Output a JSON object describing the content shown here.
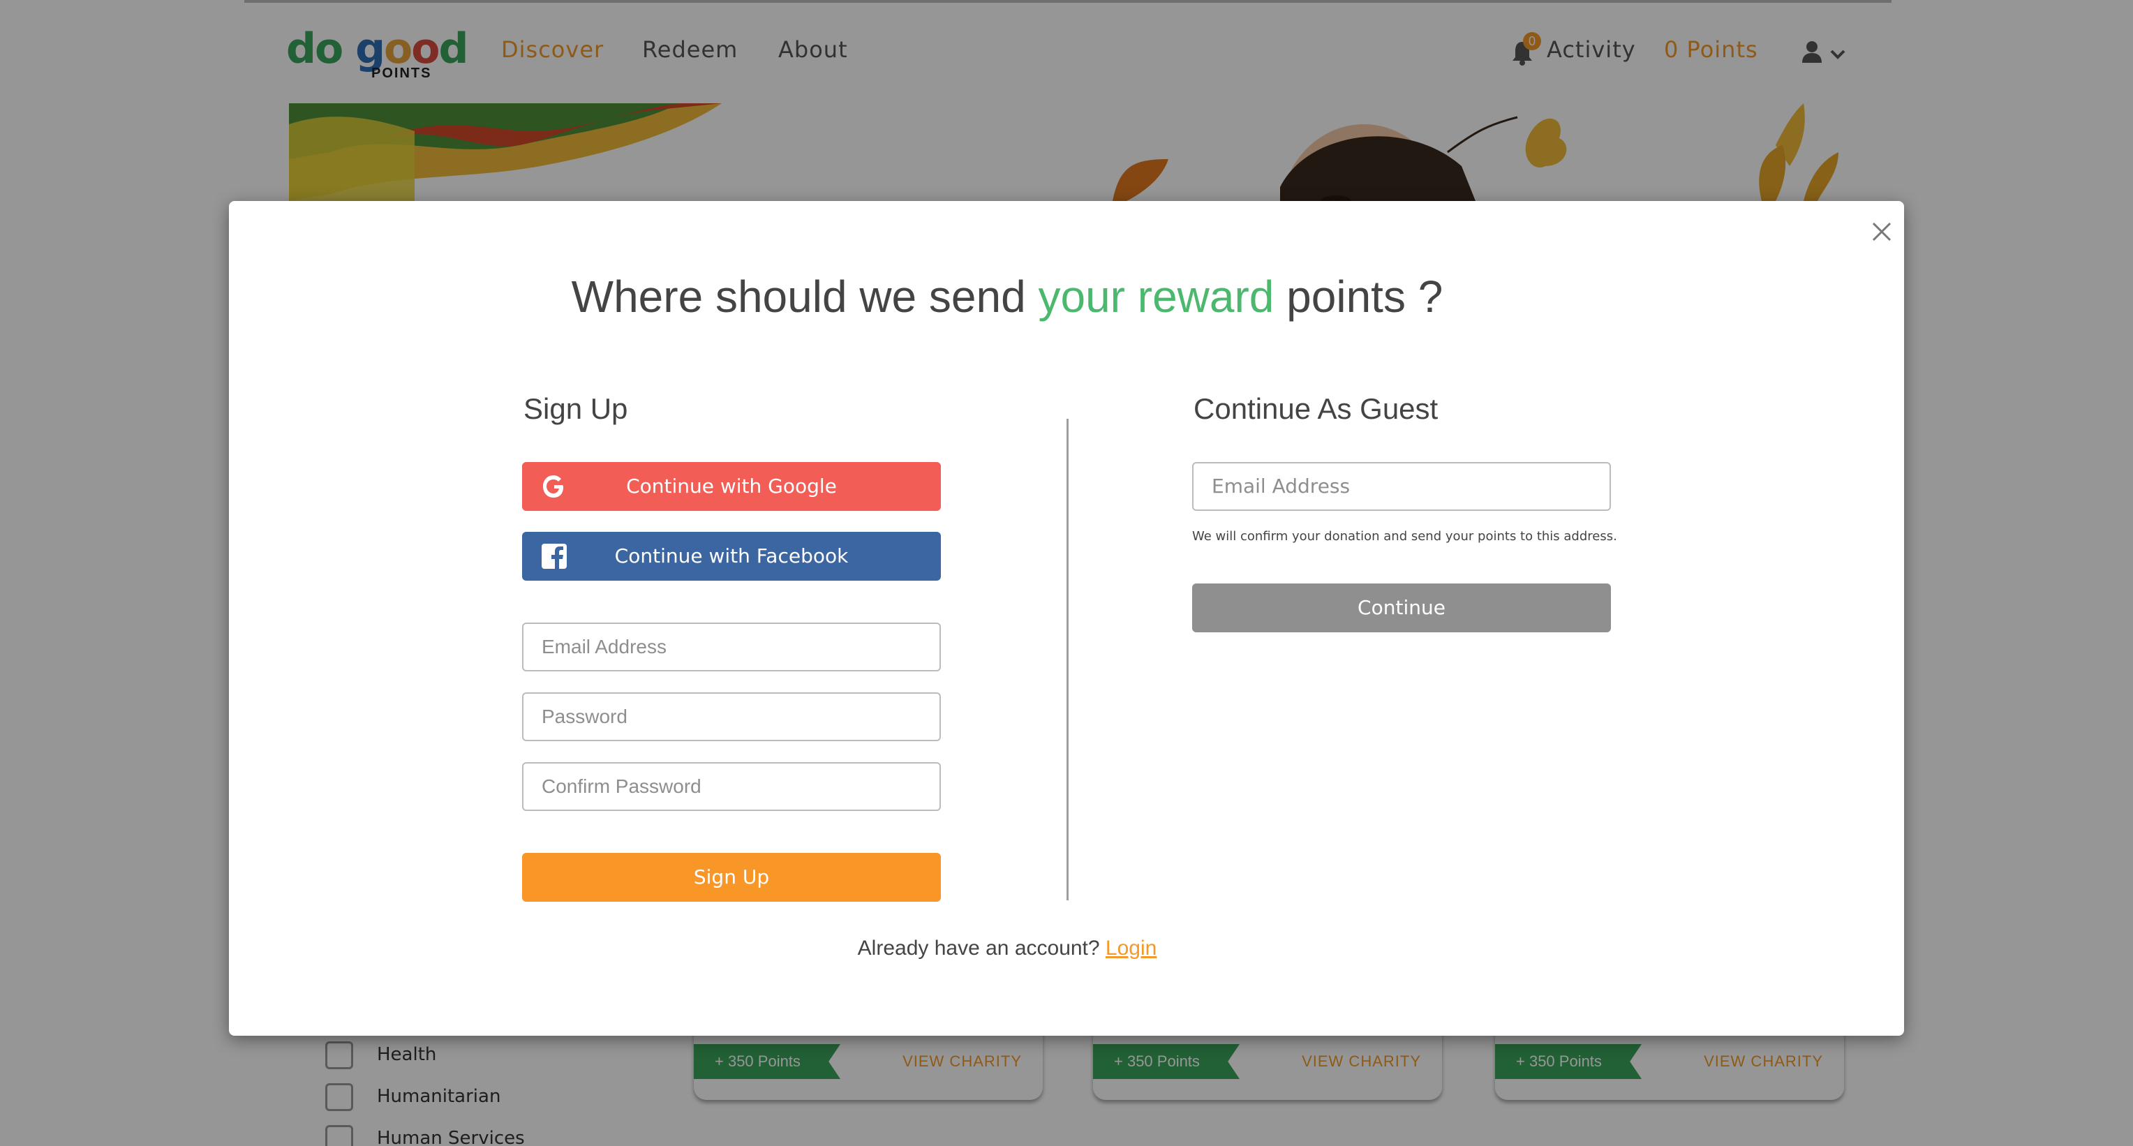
{
  "background": {
    "logo": {
      "main": "do good",
      "sub": "POINTS"
    },
    "nav": {
      "discover": "Discover",
      "redeem": "Redeem",
      "about": "About"
    },
    "activity": {
      "label": "Activity",
      "badge": "0"
    },
    "points_label": "0 Points",
    "categories": [
      "Health",
      "Humanitarian",
      "Human Services"
    ],
    "cards": [
      {
        "points": "+ 350 Points",
        "action": "VIEW CHARITY"
      },
      {
        "points": "+ 350 Points",
        "action": "VIEW CHARITY"
      },
      {
        "points": "+ 350 Points",
        "action": "VIEW CHARITY"
      }
    ],
    "colors": {
      "accent": "#f39a2a",
      "green": "#3aa35a"
    }
  },
  "modal": {
    "title_pre": "Where should we send ",
    "title_highlight": "your reward",
    "title_post": " points ?",
    "signup": {
      "heading": "Sign Up",
      "google": "Continue with Google",
      "facebook": "Continue with Facebook",
      "email_placeholder": "Email Address",
      "password_placeholder": "Password",
      "confirm_placeholder": "Confirm Password",
      "submit": "Sign Up"
    },
    "guest": {
      "heading": "Continue As Guest",
      "email_placeholder": "Email Address",
      "note": "We will confirm your donation and send your points to this address.",
      "submit": "Continue"
    },
    "footer": {
      "text": "Already have an account? ",
      "link": "Login"
    },
    "colors": {
      "highlight": "#4cb86e",
      "google": "#f25e55",
      "facebook": "#3c66a2",
      "signup": "#f99628",
      "continue": "#8f8f8f"
    }
  }
}
